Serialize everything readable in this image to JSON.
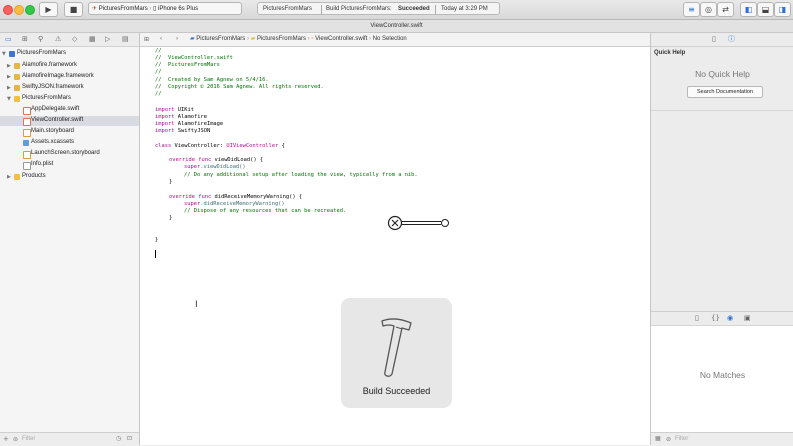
{
  "toolbar": {
    "scheme_target": "PicturesFromMars",
    "scheme_device": "iPhone 6s Plus",
    "activity_project": "PicturesFromMars",
    "activity_status_prefix": "Build PicturesFromMars:",
    "activity_status_result": "Succeeded",
    "activity_time": "Today at 3:29 PM"
  },
  "window": {
    "title": "ViewController.swift"
  },
  "navigator": {
    "items": [
      {
        "label": "PicturesFromMars",
        "kind": "project"
      },
      {
        "label": "Alamofire.framework",
        "kind": "framework"
      },
      {
        "label": "AlamofireImage.framework",
        "kind": "framework"
      },
      {
        "label": "SwiftyJSON.framework",
        "kind": "framework"
      },
      {
        "label": "PicturesFromMars",
        "kind": "group"
      },
      {
        "label": "AppDelegate.swift",
        "kind": "swift"
      },
      {
        "label": "ViewController.swift",
        "kind": "swift"
      },
      {
        "label": "Main.storyboard",
        "kind": "storyboard"
      },
      {
        "label": "Assets.xcassets",
        "kind": "assets"
      },
      {
        "label": "LaunchScreen.storyboard",
        "kind": "storyboard"
      },
      {
        "label": "Info.plist",
        "kind": "plist"
      },
      {
        "label": "Products",
        "kind": "group"
      }
    ],
    "filter_placeholder": "Filter"
  },
  "jumpbar": {
    "crumb1": "PicturesFromMars",
    "crumb2": "PicturesFromMars",
    "crumb3": "ViewController.swift",
    "crumb4": "No Selection"
  },
  "code": {
    "l1": "//",
    "l2": "//  ViewController.swift",
    "l3": "//  PicturesFromMars",
    "l4": "//",
    "l5": "//  Created by Sam Agnew on 5/4/16.",
    "l6": "//  Copyright © 2016 Sam Agnew. All rights reserved.",
    "l7": "//",
    "import_kw": "import",
    "imp1": "UIKit",
    "imp2": "Alamofire",
    "imp3": "AlamofireImage",
    "imp4": "SwiftyJSON",
    "class_kw": "class",
    "class_name": "ViewController:",
    "superclass": "UIViewController",
    "brace_open": "{",
    "override_kw": "override func",
    "fn1": "viewDidLoad() {",
    "super_kw": "super",
    "call1": ".viewDidLoad()",
    "comment1": "// Do any additional setup after loading the view, typically from a nib.",
    "close_brace": "}",
    "fn2": "didReceiveMemoryWarning() {",
    "call2": ".didReceiveMemoryWarning()",
    "comment2": "// Dispose of any resources that can be recreated.",
    "final_brace": "}"
  },
  "hud": {
    "label": "Build Succeeded"
  },
  "inspector": {
    "quick_help_title": "Quick Help",
    "no_quick_help": "No Quick Help",
    "search_button": "Search Documentation",
    "no_matches": "No Matches",
    "filter_placeholder": "Filter"
  },
  "colors": {
    "keyword": "#aa0d91",
    "comment": "#007400",
    "type": "#3f6e74",
    "folder": "#f3c042"
  }
}
